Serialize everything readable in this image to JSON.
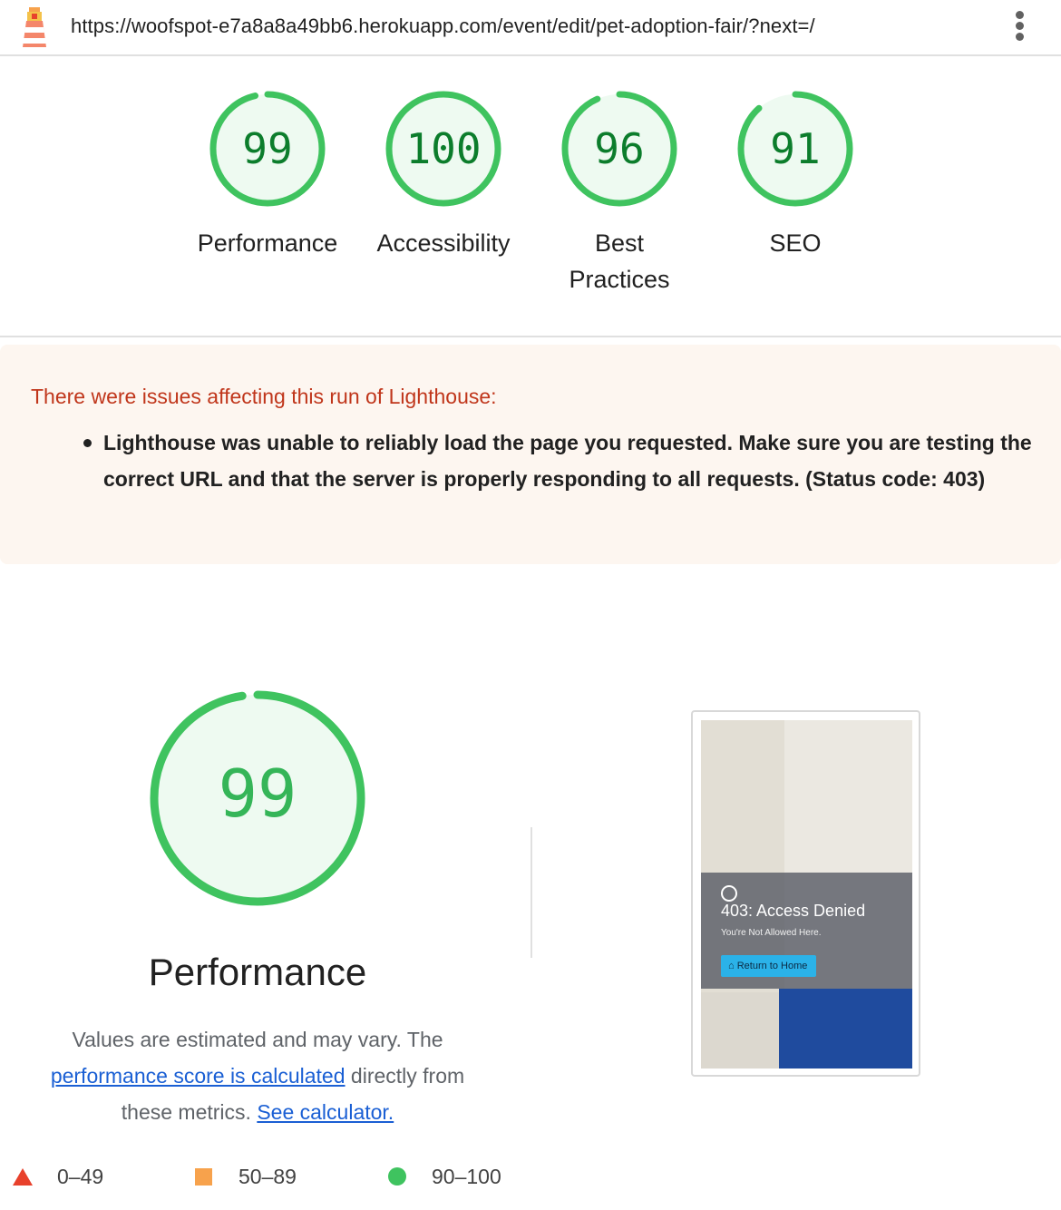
{
  "browser": {
    "url": "https://woofspot-e7a8a8a49bb6.herokuapp.com/event/edit/pet-adoption-fair/?next=/",
    "menu_icon": "more-vert-icon"
  },
  "gauges": [
    {
      "score": "99",
      "label": "Performance",
      "fraction": 0.99
    },
    {
      "score": "100",
      "label": "Accessibility",
      "fraction": 1.0
    },
    {
      "score": "96",
      "label": "Best Practices",
      "fraction": 0.96
    },
    {
      "score": "91",
      "label": "SEO",
      "fraction": 0.91
    }
  ],
  "warning": {
    "title": "There were issues affecting this run of Lighthouse:",
    "items": [
      "Lighthouse was unable to reliably load the page you requested. Make sure you are testing the correct URL and that the server is properly responding to all requests. (Status code: 403)"
    ]
  },
  "performance": {
    "score": "99",
    "fraction": 0.99,
    "title": "Performance",
    "desc_part1": "Values are estimated and may vary. The",
    "desc_link1": "performance score is calculated",
    "desc_part2": " directly from these metrics.",
    "desc_link2": "See calculator."
  },
  "screenshot": {
    "heading": "403: Access Denied",
    "subtext": "You're Not Allowed Here.",
    "button": "Return to Home"
  },
  "legend": [
    {
      "range": "0–49",
      "shape": "triangle",
      "color": "#e8412c"
    },
    {
      "range": "50–89",
      "shape": "square",
      "color": "#f7a24c"
    },
    {
      "range": "90–100",
      "shape": "circle",
      "color": "#3fc35f"
    }
  ]
}
